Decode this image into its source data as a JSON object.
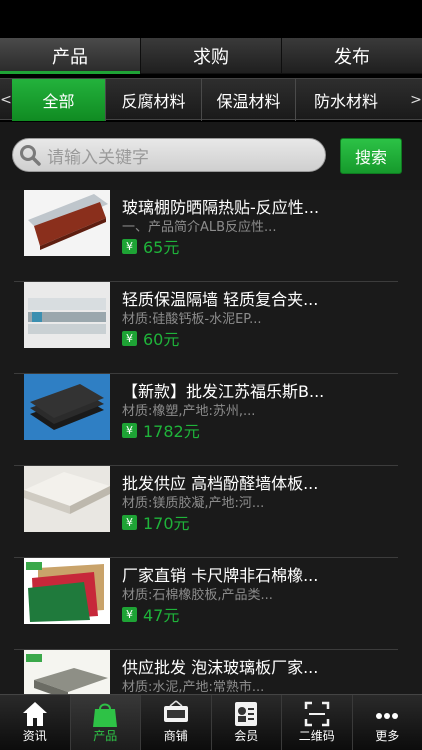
{
  "top_tabs": [
    {
      "label": "产品"
    },
    {
      "label": "求购"
    },
    {
      "label": "发布"
    }
  ],
  "categories": {
    "left_arrow": "<",
    "right_arrow": ">",
    "items": [
      {
        "label": "全部"
      },
      {
        "label": "反腐材料"
      },
      {
        "label": "保温材料"
      },
      {
        "label": "防水材料"
      }
    ]
  },
  "search": {
    "placeholder": "请输入关键字",
    "button_label": "搜索",
    "icon": "search-icon"
  },
  "products": [
    {
      "title": "玻璃棚防晒隔热贴-反应性...",
      "desc": "一、产品简介ALB反应性...",
      "price": "65元",
      "currency_icon": "¥"
    },
    {
      "title": "轻质保温隔墙 轻质复合夹...",
      "desc": "材质:硅酸钙板-水泥EP...",
      "price": "60元",
      "currency_icon": "¥"
    },
    {
      "title": "【新款】批发江苏福乐斯B...",
      "desc": "材质:橡塑,产地:苏州,...",
      "price": "1782元",
      "currency_icon": "¥"
    },
    {
      "title": "批发供应 高档酚醛墙体板...",
      "desc": "材质:镁质胶凝,产地:河...",
      "price": "170元",
      "currency_icon": "¥"
    },
    {
      "title": "厂家直销 卡尺牌非石棉橡...",
      "desc": "材质:石棉橡胶板,产品类...",
      "price": "47元",
      "currency_icon": "¥"
    },
    {
      "title": "供应批发 泡沫玻璃板厂家...",
      "desc": "材质:水泥,产地:常熟市...",
      "price": "",
      "currency_icon": "¥"
    }
  ],
  "bottom_nav": [
    {
      "label": "资讯",
      "icon": "home-icon"
    },
    {
      "label": "产品",
      "icon": "shopping-bag-icon"
    },
    {
      "label": "商铺",
      "icon": "open-sign-icon"
    },
    {
      "label": "会员",
      "icon": "member-card-icon"
    },
    {
      "label": "二维码",
      "icon": "qr-scan-icon"
    },
    {
      "label": "更多",
      "icon": "more-dots-icon"
    }
  ],
  "colors": {
    "accent_green": "#1fa336",
    "price_green": "#1fb33a",
    "background": "#1a1a1a"
  }
}
